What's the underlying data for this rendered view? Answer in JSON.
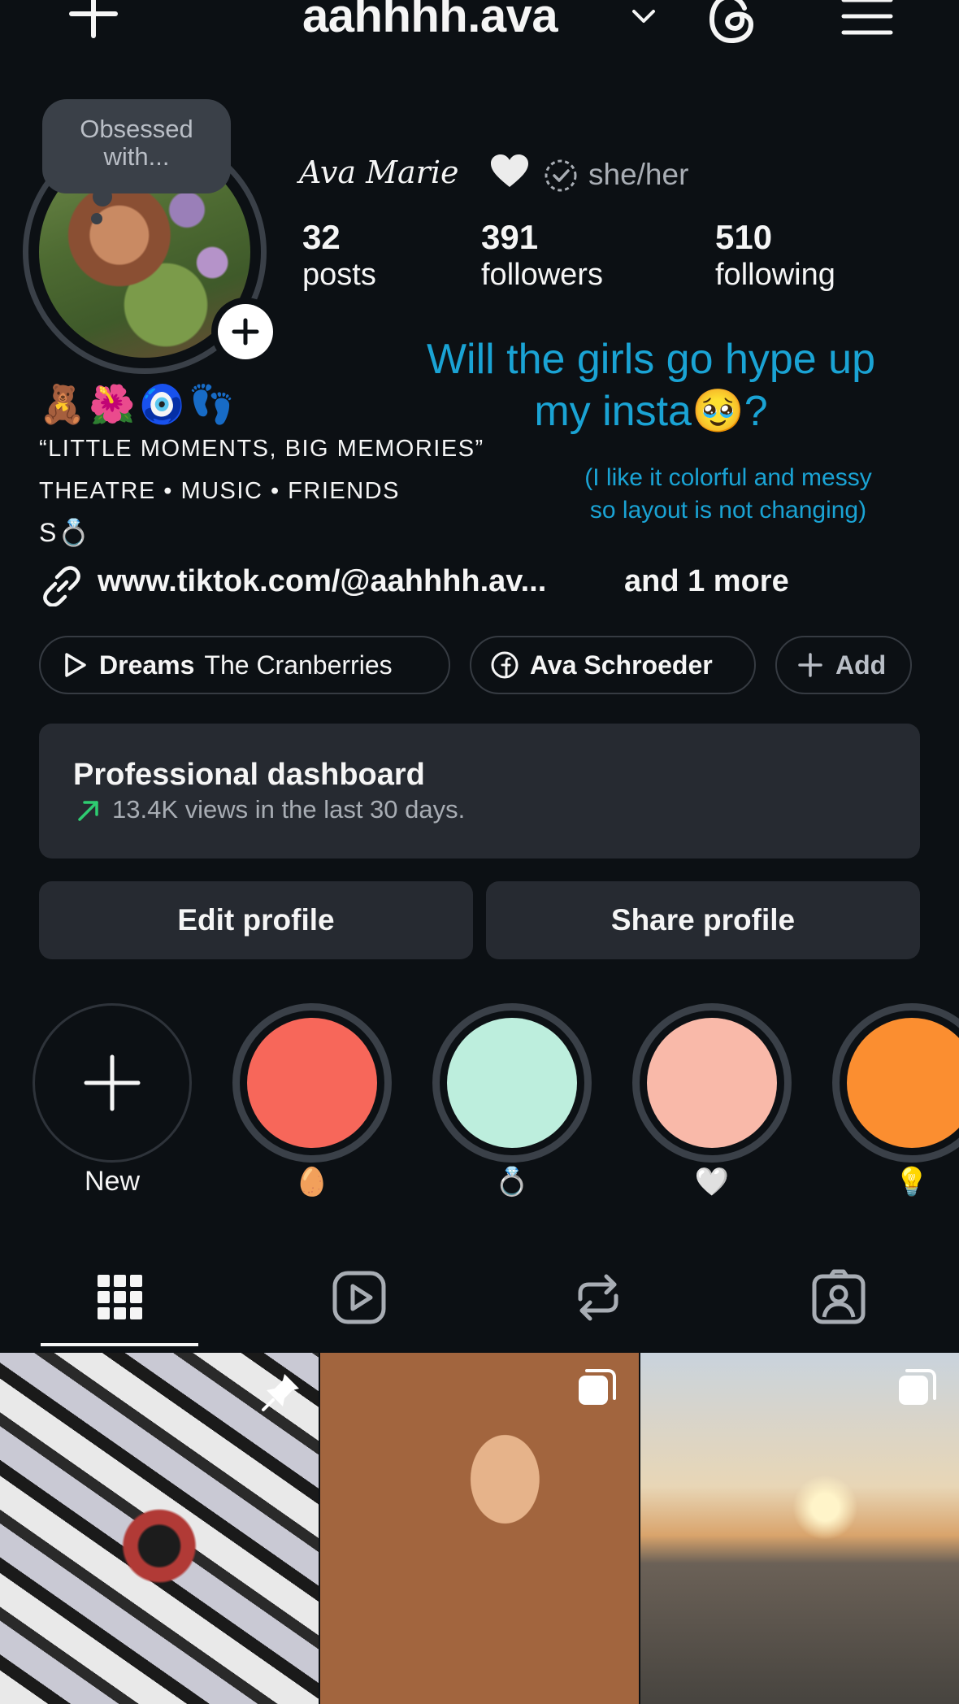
{
  "header": {
    "username": "aahhhh.ava"
  },
  "profile": {
    "note": "Obsessed with...",
    "display_name": "Ava Marie",
    "pronouns": "she/her",
    "stats": [
      {
        "value": "32",
        "label": "posts"
      },
      {
        "value": "391",
        "label": "followers"
      },
      {
        "value": "510",
        "label": "following"
      }
    ],
    "bio_emoji": "🧸🌺🧿👣",
    "bio_lines": [
      "“LITTLE MOMENTS, BIG MEMORIES”",
      "THEATRE • MUSIC • FRIENDS",
      "S💍"
    ],
    "link": "www.tiktok.com/@aahhhh.av...",
    "link_more": "and 1 more"
  },
  "overlay": {
    "callout_line1": "Will the girls go hype up",
    "callout_line2": "my insta🥹?",
    "note_line1": "(I like it colorful and messy",
    "note_line2": "so layout is not changing)"
  },
  "pills": {
    "music_title": "Dreams",
    "music_artist": "The Cranberries",
    "facebook_name": "Ava Schroeder",
    "add_label": "Add"
  },
  "dashboard": {
    "title": "Professional dashboard",
    "subtitle": "13.4K views in the last 30 days."
  },
  "buttons": {
    "edit": "Edit profile",
    "share": "Share profile"
  },
  "highlights": [
    {
      "label": "New",
      "color": ""
    },
    {
      "label": "🥚",
      "color": "#f7675a"
    },
    {
      "label": "💍",
      "color": "#bdeedd"
    },
    {
      "label": "🤍",
      "color": "#f9b9a9"
    },
    {
      "label": "💡",
      "color": "#fb8e30"
    }
  ],
  "colors": {
    "background": "#0c1014",
    "surface": "#262a31",
    "accent_callout": "#1aa3d4",
    "trend_up": "#2ecc71"
  }
}
